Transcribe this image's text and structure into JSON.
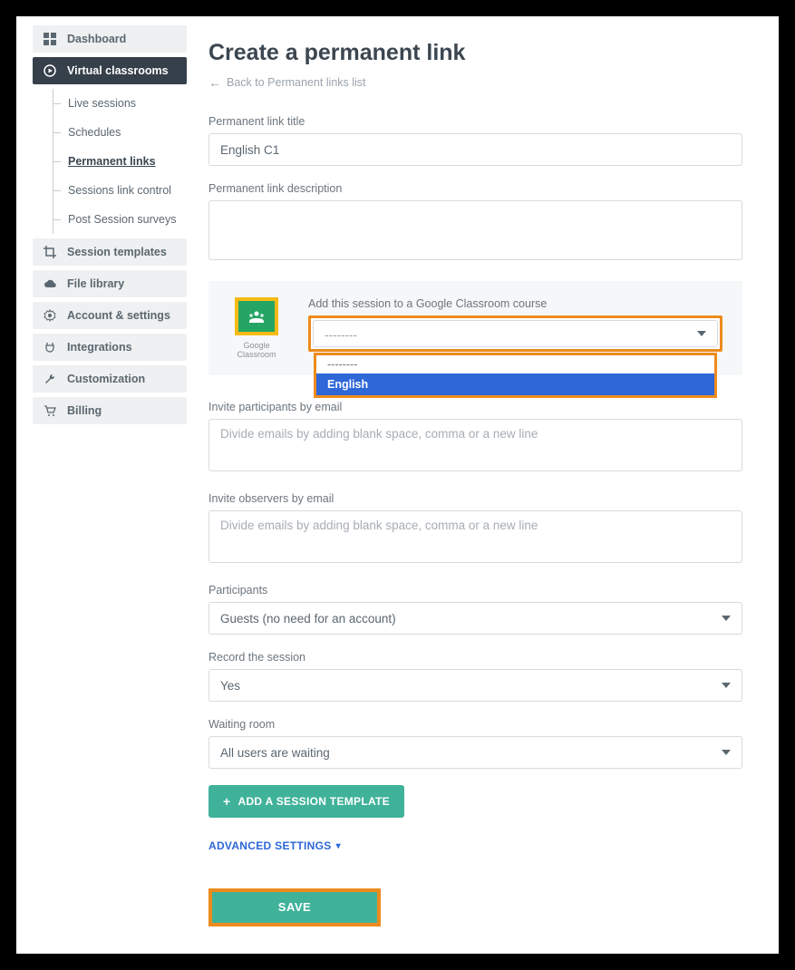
{
  "sidebar": {
    "items": [
      {
        "label": "Dashboard"
      },
      {
        "label": "Virtual classrooms"
      },
      {
        "label": "Session templates"
      },
      {
        "label": "File library"
      },
      {
        "label": "Account & settings"
      },
      {
        "label": "Integrations"
      },
      {
        "label": "Customization"
      },
      {
        "label": "Billing"
      }
    ],
    "sub": [
      {
        "label": "Live sessions"
      },
      {
        "label": "Schedules"
      },
      {
        "label": "Permanent links"
      },
      {
        "label": "Sessions link control"
      },
      {
        "label": "Post Session surveys"
      }
    ]
  },
  "main": {
    "title": "Create a permanent link",
    "back": "Back to Permanent links list",
    "link_title_label": "Permanent link title",
    "link_title_value": "English C1",
    "link_desc_label": "Permanent link description",
    "gc": {
      "caption": "Google Classroom",
      "label": "Add this session to a Google Classroom course",
      "select_value": "--------",
      "options": {
        "blank": "--------",
        "english": "English"
      }
    },
    "invite_participants_label": "Invite participants by email",
    "invite_placeholder": "Divide emails by adding blank space, comma or a new line",
    "invite_observers_label": "Invite observers by email",
    "participants_label": "Participants",
    "participants_value": "Guests (no need for an account)",
    "record_label": "Record the session",
    "record_value": "Yes",
    "waiting_label": "Waiting room",
    "waiting_value": "All users are waiting",
    "add_template": "ADD A SESSION TEMPLATE",
    "advanced": "ADVANCED SETTINGS",
    "save": "SAVE"
  }
}
